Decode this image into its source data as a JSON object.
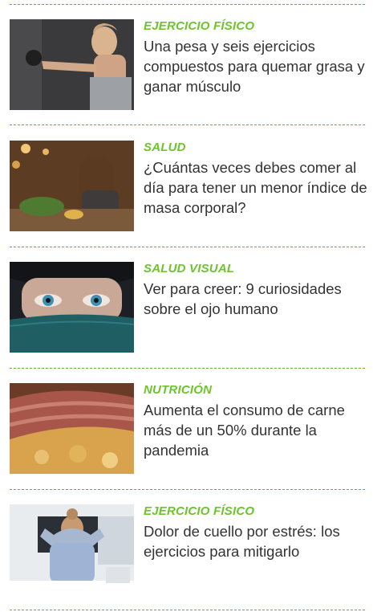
{
  "articles": [
    {
      "category": "EJERCICIO FÍSICO",
      "title": "Una pesa y seis ejercicios compuestos para quemar grasa y ganar músculo",
      "image": "woman-kettlebell-photo"
    },
    {
      "category": "SALUD",
      "title": "¿Cuántas veces debes comer al día para tener un menor índice de masa corporal?",
      "image": "woman-eating-photo"
    },
    {
      "category": "SALUD VISUAL",
      "title": "Ver para creer: 9 curiosidades sobre el ojo humano",
      "image": "eyes-closeup-photo"
    },
    {
      "category": "NUTRICIÓN",
      "title": "Aumenta el consumo de carne más de un 50% durante la pandemia",
      "image": "steak-photo"
    },
    {
      "category": "EJERCICIO FÍSICO",
      "title": "Dolor de cuello por estrés: los ejercicios para mitigarlo",
      "image": "woman-neck-pain-photo"
    }
  ],
  "colors": {
    "category": "#6cc52a",
    "title": "#333333",
    "separator": "#63b52c"
  }
}
